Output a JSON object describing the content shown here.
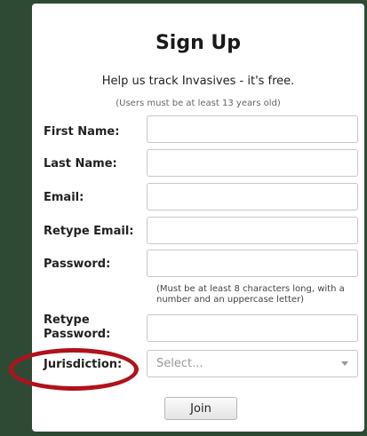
{
  "title": "Sign Up",
  "subtitle": "Help us track Invasives - it's free.",
  "age_note": "(Users must be at least 13 years old)",
  "fields": {
    "first_name": {
      "label": "First Name:",
      "value": ""
    },
    "last_name": {
      "label": "Last Name:",
      "value": ""
    },
    "email": {
      "label": "Email:",
      "value": ""
    },
    "retype_email": {
      "label": "Retype Email:",
      "value": ""
    },
    "password": {
      "label": "Password:",
      "value": ""
    },
    "retype_password": {
      "label": "Retype Password:",
      "value": ""
    }
  },
  "password_note": "(Must be at least 8 characters long, with a number and an uppercase letter)",
  "jurisdiction": {
    "label": "Jurisdiction:",
    "selected": "Select..."
  },
  "join_label": "Join",
  "colors": {
    "annotation_circle": "#b0121b",
    "background": "#2f4a34"
  }
}
